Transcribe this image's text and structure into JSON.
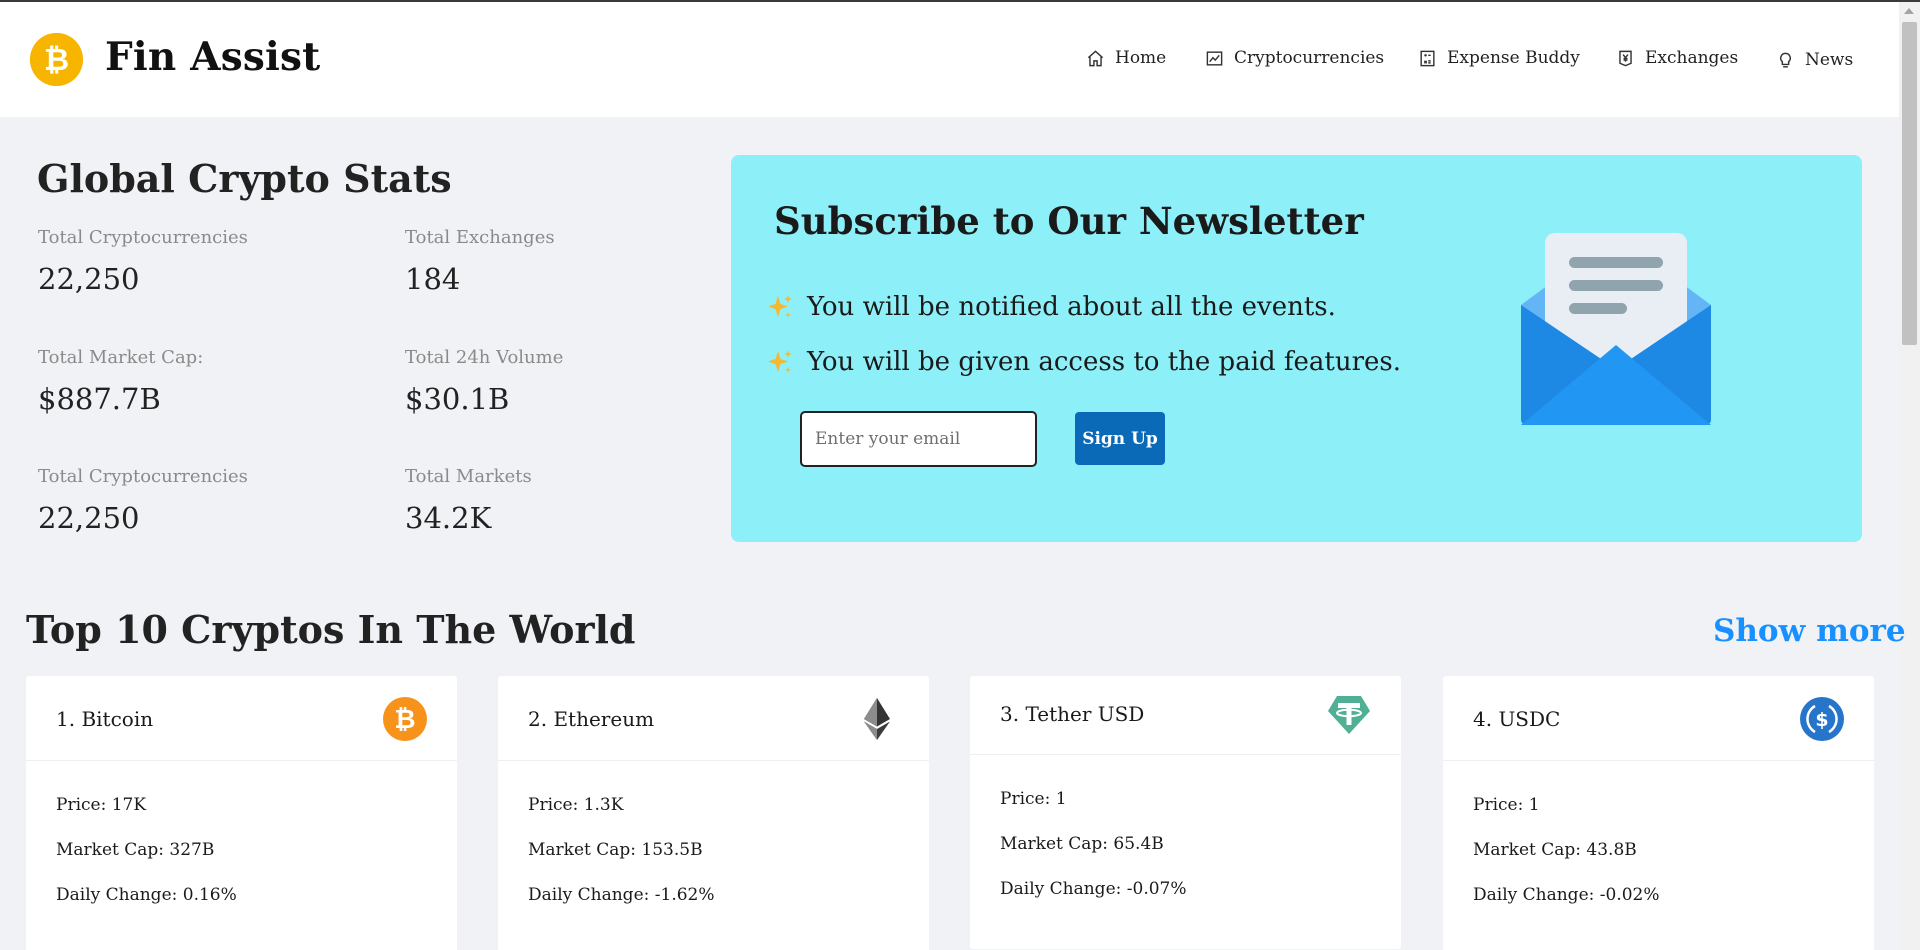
{
  "app": {
    "brand": "Fin Assist"
  },
  "nav": {
    "home": "Home",
    "cryptocurrencies": "Cryptocurrencies",
    "expense_buddy": "Expense Buddy",
    "exchanges": "Exchanges",
    "news": "News"
  },
  "stats": {
    "title": "Global Crypto Stats",
    "items": [
      {
        "label": "Total Cryptocurrencies",
        "value": "22,250"
      },
      {
        "label": "Total Exchanges",
        "value": "184"
      },
      {
        "label": "Total Market Cap:",
        "value": "$887.7B"
      },
      {
        "label": "Total 24h Volume",
        "value": "$30.1B"
      },
      {
        "label": "Total Cryptocurrencies",
        "value": "22,250"
      },
      {
        "label": "Total Markets",
        "value": "34.2K"
      }
    ]
  },
  "newsletter": {
    "title": "Subscribe to Our Newsletter",
    "point_1": "You will be notified about all the events.",
    "point_2": "You will be given access to the paid features.",
    "email_placeholder": "Enter your email",
    "email_value": "",
    "signup_label": "Sign Up",
    "accent_color": "#8df0f8",
    "button_color": "#0b6ab8"
  },
  "top": {
    "title": "Top 10 Cryptos In The World",
    "show_more": "Show more",
    "cards": [
      {
        "name": "1. Bitcoin",
        "price": "Price: 17K",
        "market_cap": "Market Cap: 327B",
        "daily_change": "Daily Change: 0.16%",
        "icon": "bitcoin-icon"
      },
      {
        "name": "2. Ethereum",
        "price": "Price: 1.3K",
        "market_cap": "Market Cap: 153.5B",
        "daily_change": "Daily Change: -1.62%",
        "icon": "ethereum-icon"
      },
      {
        "name": "3. Tether USD",
        "price": "Price: 1",
        "market_cap": "Market Cap: 65.4B",
        "daily_change": "Daily Change: -0.07%",
        "icon": "tether-icon"
      },
      {
        "name": "4. USDC",
        "price": "Price: 1",
        "market_cap": "Market Cap: 43.8B",
        "daily_change": "Daily Change: -0.02%",
        "icon": "usdc-icon"
      }
    ]
  }
}
